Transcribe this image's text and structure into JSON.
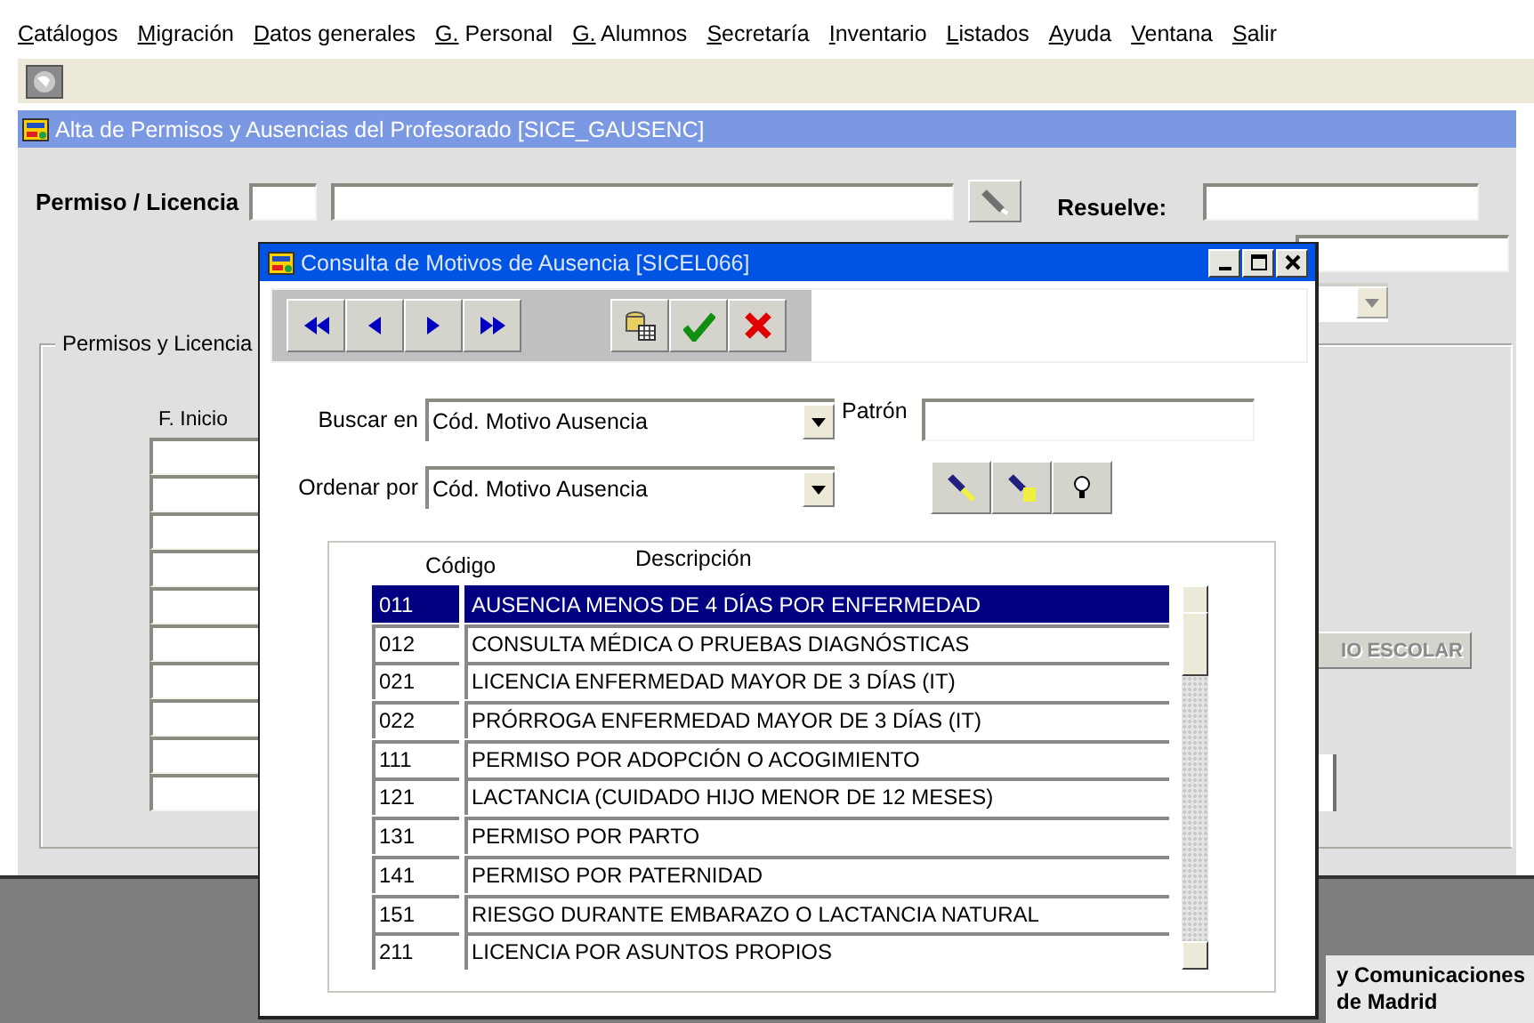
{
  "menu_bar": [
    {
      "label": "Catálogos"
    },
    {
      "label": "Migración"
    },
    {
      "label": "Datos generales"
    },
    {
      "label": "G. Personal"
    },
    {
      "label": "G. Alumnos"
    },
    {
      "label": "Secretaría"
    },
    {
      "label": "Inventario"
    },
    {
      "label": "Listados"
    },
    {
      "label": "Ayuda"
    },
    {
      "label": "Ventana"
    },
    {
      "label": "Salir"
    }
  ],
  "main_window": {
    "title": "Alta de Permisos y Ausencias del Profesorado [SICE_GAUSENC]",
    "permiso_label": "Permiso / Licencia",
    "resuelve_label": "Resuelve:",
    "group_title": "Permisos y Licencia",
    "column_header": "F. Inicio",
    "side_button": {
      "label": "IO ESCOLAR",
      "disabled": true
    },
    "footer_lines": [
      "y Comunicaciones",
      "de Madrid"
    ]
  },
  "dialog": {
    "title": "Consulta de Motivos de Ausencia [SICEL066]",
    "search_label": "Buscar en",
    "search_field": {
      "value": "Cód. Motivo Ausencia"
    },
    "pattern_label": "Patrón",
    "order_label": "Ordenar por",
    "order_field": {
      "value": "Cód. Motivo Ausencia"
    },
    "table": {
      "columns": [
        "Código",
        "Descripción"
      ],
      "rows": [
        {
          "code": "011",
          "description": "AUSENCIA MENOS DE 4 DÍAS POR ENFERMEDAD",
          "selected": true
        },
        {
          "code": "012",
          "description": "CONSULTA MÉDICA O PRUEBAS DIAGNÓSTICAS",
          "selected": false
        },
        {
          "code": "021",
          "description": "LICENCIA ENFERMEDAD MAYOR DE 3 DÍAS (IT)",
          "selected": false
        },
        {
          "code": "022",
          "description": "PRÓRROGA ENFERMEDAD MAYOR DE 3 DÍAS (IT)",
          "selected": false
        },
        {
          "code": "111",
          "description": "PERMISO POR ADOPCIÓN O ACOGIMIENTO",
          "selected": false
        },
        {
          "code": "121",
          "description": "LACTANCIA (CUIDADO HIJO MENOR DE 12 MESES)",
          "selected": false
        },
        {
          "code": "131",
          "description": "PERMISO POR PARTO",
          "selected": false
        },
        {
          "code": "141",
          "description": "PERMISO POR PATERNIDAD",
          "selected": false
        },
        {
          "code": "151",
          "description": "RIESGO DURANTE EMBARAZO O LACTANCIA NATURAL",
          "selected": false
        },
        {
          "code": "211",
          "description": "LICENCIA POR ASUNTOS PROPIOS",
          "selected": false
        }
      ]
    }
  }
}
